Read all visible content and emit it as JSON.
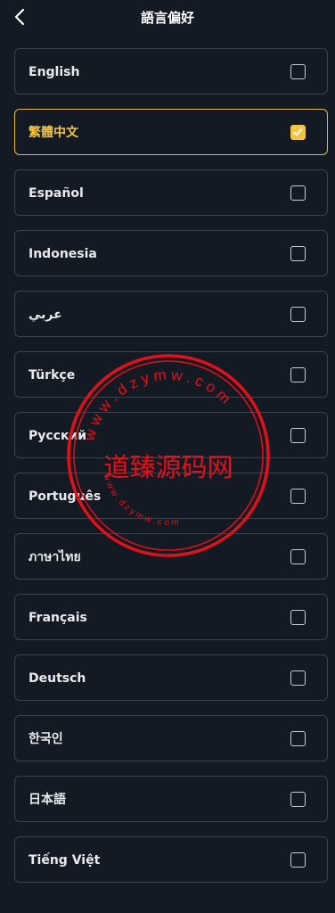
{
  "header": {
    "title": "語言偏好",
    "back_icon": "chevron-left-icon"
  },
  "languages": [
    {
      "label": "English",
      "selected": false
    },
    {
      "label": "繁體中文",
      "selected": true
    },
    {
      "label": "Español",
      "selected": false
    },
    {
      "label": "Indonesia",
      "selected": false
    },
    {
      "label": "عربي",
      "selected": false
    },
    {
      "label": "Türkçe",
      "selected": false
    },
    {
      "label": "Русский",
      "selected": false
    },
    {
      "label": "Português",
      "selected": false
    },
    {
      "label": "ภาษาไทย",
      "selected": false
    },
    {
      "label": "Français",
      "selected": false
    },
    {
      "label": "Deutsch",
      "selected": false
    },
    {
      "label": "한국인",
      "selected": false
    },
    {
      "label": "日本語",
      "selected": false
    },
    {
      "label": "Tiếng Việt",
      "selected": false
    }
  ],
  "watermark": {
    "center_text": "道臻源码网",
    "ring_text": "www.dzymw.com",
    "color": "#e3101a"
  },
  "colors": {
    "background": "#141a24",
    "accent": "#f2c544",
    "item_border": "#3a4250"
  }
}
